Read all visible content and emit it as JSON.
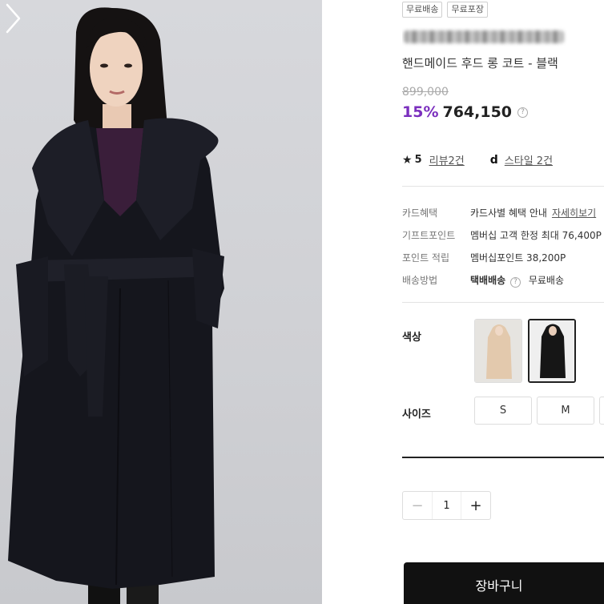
{
  "gallery": {
    "next_icon": "chevron-right-icon"
  },
  "badges": [
    "무료배송",
    "무료포장"
  ],
  "product": {
    "title": "핸드메이드 후드 롱 코트 - 블랙",
    "original_price": "899,000",
    "discount": "15%",
    "price": "764,150",
    "price_help_icon": "?"
  },
  "rating": {
    "star_icon": "★",
    "score": "5",
    "reviews_label": "리뷰2건",
    "style_icon": "d",
    "style_label": "스타일 2건"
  },
  "specs": [
    {
      "label": "카드혜택",
      "value": "카드사별 혜택 안내",
      "link": "자세히보기"
    },
    {
      "label": "기프트포인트",
      "value": "멤버십 고객 한정 최대 76,400P"
    },
    {
      "label": "포인트 적립",
      "value": "멤버십포인트 38,200P"
    },
    {
      "label": "배송방법",
      "value": "택배배송",
      "help": "?",
      "extra": "무료배송"
    }
  ],
  "options": {
    "color_label": "색상",
    "size_label": "사이즈",
    "sizes": [
      "S",
      "M"
    ],
    "color_swatches": [
      "beige",
      "black"
    ]
  },
  "quantity": {
    "minus": "−",
    "value": "1",
    "plus": "+"
  },
  "cart_button": "장바구니",
  "colors": {
    "accent": "#7b2fbe",
    "coat": "#14151c",
    "background": "#d3d4d8"
  }
}
